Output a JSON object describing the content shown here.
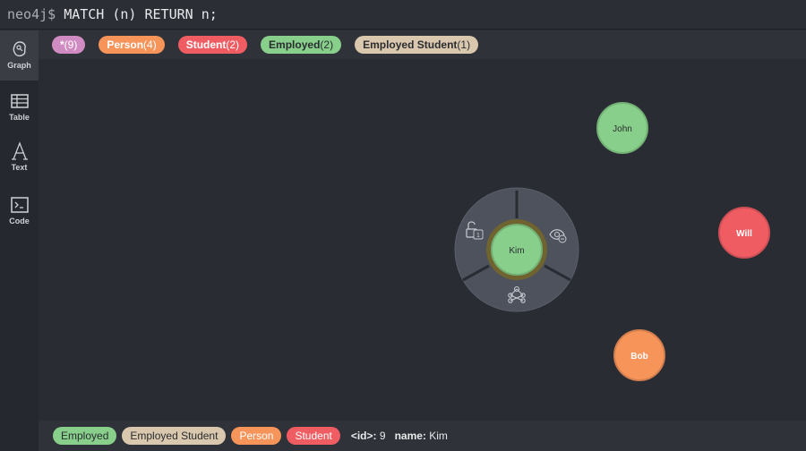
{
  "query_bar": {
    "prompt": "neo4j$",
    "query": "MATCH (n) RETURN n;"
  },
  "sidebar": {
    "items": [
      {
        "label": "Graph",
        "icon": "graph-icon",
        "active": true
      },
      {
        "label": "Table",
        "icon": "table-icon",
        "active": false
      },
      {
        "label": "Text",
        "icon": "text-icon",
        "active": false
      },
      {
        "label": "Code",
        "icon": "code-icon",
        "active": false
      }
    ]
  },
  "labels_bar": {
    "chips": [
      {
        "name": "*",
        "count": "(9)",
        "color": "#d08cc2",
        "text_color": "#ffffff"
      },
      {
        "name": "Person",
        "count": "(4)",
        "color": "#f7945a",
        "text_color": "#ffffff"
      },
      {
        "name": "Student",
        "count": "(2)",
        "color": "#ef5d63",
        "text_color": "#ffffff"
      },
      {
        "name": "Employed",
        "count": "(2)",
        "color": "#87cf8a",
        "text_color": "#2a2c30"
      },
      {
        "name": "Employed Student",
        "count": "(1)",
        "color": "#d9c8ae",
        "text_color": "#2a2c30"
      }
    ]
  },
  "graph": {
    "nodes": [
      {
        "label": "John",
        "color": "#87cf8a",
        "text_color": "#2a2c30"
      },
      {
        "label": "Will",
        "color": "#ef5d63",
        "text_color": "#ffffff"
      },
      {
        "label": "Bob",
        "color": "#f7945a",
        "text_color": "#ffffff"
      },
      {
        "label": "Kim",
        "color": "#87cf8a",
        "text_color": "#2a2c30",
        "selected": true
      }
    ],
    "context_menu": {
      "actions": [
        {
          "name": "unlock-icon",
          "badge": "1"
        },
        {
          "name": "hide-icon"
        },
        {
          "name": "expand-icon"
        }
      ]
    }
  },
  "status_bar": {
    "labels": [
      {
        "name": "Employed",
        "color": "#87cf8a",
        "text_color": "#2a2c30"
      },
      {
        "name": "Employed Student",
        "color": "#d9c8ae",
        "text_color": "#2a2c30"
      },
      {
        "name": "Person",
        "color": "#f7945a",
        "text_color": "#ffffff"
      },
      {
        "name": "Student",
        "color": "#ef5d63",
        "text_color": "#ffffff"
      }
    ],
    "properties": [
      {
        "key": "<id>:",
        "value": "9"
      },
      {
        "key": "name:",
        "value": "Kim"
      }
    ]
  }
}
